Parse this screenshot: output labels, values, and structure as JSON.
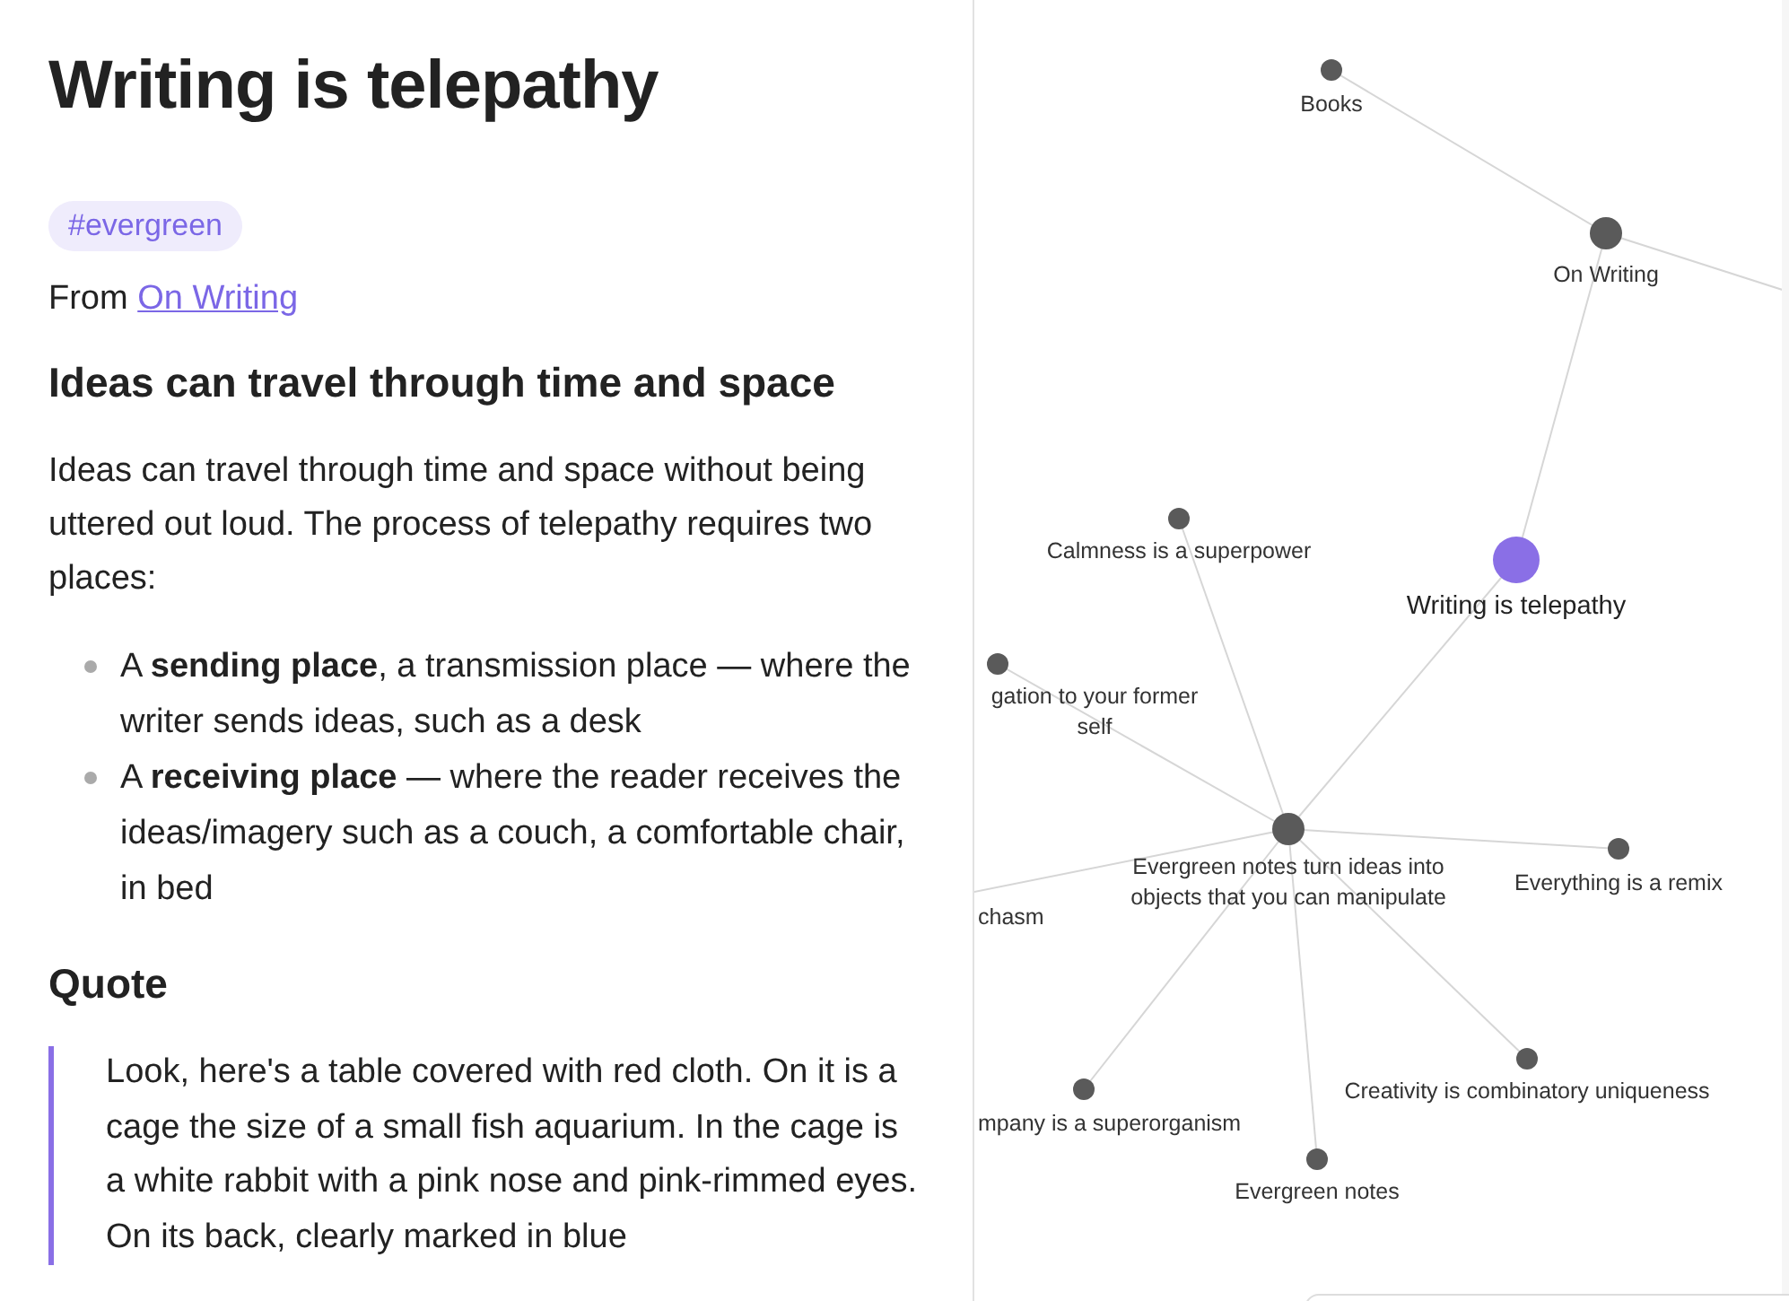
{
  "note": {
    "title": "Writing is telepathy",
    "tag": "#evergreen",
    "from_label": "From",
    "from_link": "On Writing",
    "heading": "Ideas can travel through time and space",
    "paragraph": "Ideas can travel through time and space without being uttered out loud. The process of telepathy requires two places:",
    "bullets": [
      "A **sending place**, a transmission place — where the writer sends ideas, such as a desk",
      "A **receiving place** — where the reader receives the ideas/imagery such as a couch, a comfortable chair, in bed"
    ],
    "quote_heading": "Quote",
    "quote": "Look, here's a table covered with red cloth. On it is a cage the size of a small fish aquarium. In the cage is a white rabbit with a pink nose and pink-rimmed eyes. On its back, clearly marked in blue"
  },
  "graph": {
    "nodes": [
      {
        "label": "Books",
        "selected": false
      },
      {
        "label": "On Writing",
        "selected": false
      },
      {
        "label": "Writing is telepathy",
        "selected": true
      },
      {
        "label": "Calmness is a superpower",
        "selected": false
      },
      {
        "label": "gation to your former self",
        "selected": false
      },
      {
        "label": "Evergreen notes turn ideas into objects that you can manipulate",
        "selected": false
      },
      {
        "label": "Everything is a remix",
        "selected": false
      },
      {
        "label": "chasm",
        "selected": false
      },
      {
        "label": "mpany is a superorganism",
        "selected": false
      },
      {
        "label": "Evergreen notes",
        "selected": false
      },
      {
        "label": "Creativity is combinatory uniqueness",
        "selected": false
      }
    ]
  }
}
